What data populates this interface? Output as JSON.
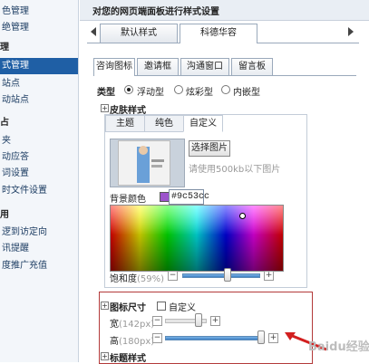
{
  "sidebar": {
    "items": [
      {
        "label": "色管理",
        "kind": "item"
      },
      {
        "label": "绝管理",
        "kind": "item"
      },
      {
        "label": "理",
        "kind": "section"
      },
      {
        "label": "式管理",
        "kind": "active"
      },
      {
        "label": "站点",
        "kind": "item"
      },
      {
        "label": "动站点",
        "kind": "item"
      },
      {
        "label": "占",
        "kind": "section"
      },
      {
        "label": "夹",
        "kind": "item"
      },
      {
        "label": "动应答",
        "kind": "item"
      },
      {
        "label": "词设置",
        "kind": "item"
      },
      {
        "label": "时文件设置",
        "kind": "item"
      },
      {
        "label": "用",
        "kind": "section"
      },
      {
        "label": "逻到访定向",
        "kind": "item"
      },
      {
        "label": "讯提醒",
        "kind": "item"
      },
      {
        "label": "度推广充值",
        "kind": "item"
      }
    ]
  },
  "header": {
    "title": "对您的网页端面板进行样式设置"
  },
  "style_tabs": [
    {
      "label": "默认样式"
    },
    {
      "label": "科德华容"
    }
  ],
  "sub_tabs": [
    {
      "label": "咨询图标"
    },
    {
      "label": "邀请框"
    },
    {
      "label": "沟通窗口"
    },
    {
      "label": "留言板"
    }
  ],
  "type_row": {
    "label": "类型",
    "options": [
      {
        "label": "浮动型",
        "selected": true
      },
      {
        "label": "炫彩型",
        "selected": false
      },
      {
        "label": "内嵌型",
        "selected": false
      }
    ]
  },
  "skin": {
    "section_label": "皮肤样式",
    "tabs": [
      {
        "label": "主题"
      },
      {
        "label": "纯色"
      },
      {
        "label": "自定义"
      }
    ],
    "select_image_button": "选择图片",
    "hint": "请使用500kb以下图片",
    "bg_color_label": "背景颜色",
    "bg_color_hash": "#",
    "bg_color_value": "9c53cc",
    "saturation_label": "饱和度",
    "saturation_value": "(59%)",
    "saturation_fraction": 0.59,
    "swatch_color": "#9c53cc"
  },
  "icon_size": {
    "section_label": "图标尺寸",
    "custom_label": "自定义",
    "width_label": "宽",
    "width_value": "(142px)",
    "height_label": "高",
    "height_value": "(180px)"
  },
  "title_style": {
    "section_label": "标题样式"
  },
  "watermark": "Baidu经验"
}
